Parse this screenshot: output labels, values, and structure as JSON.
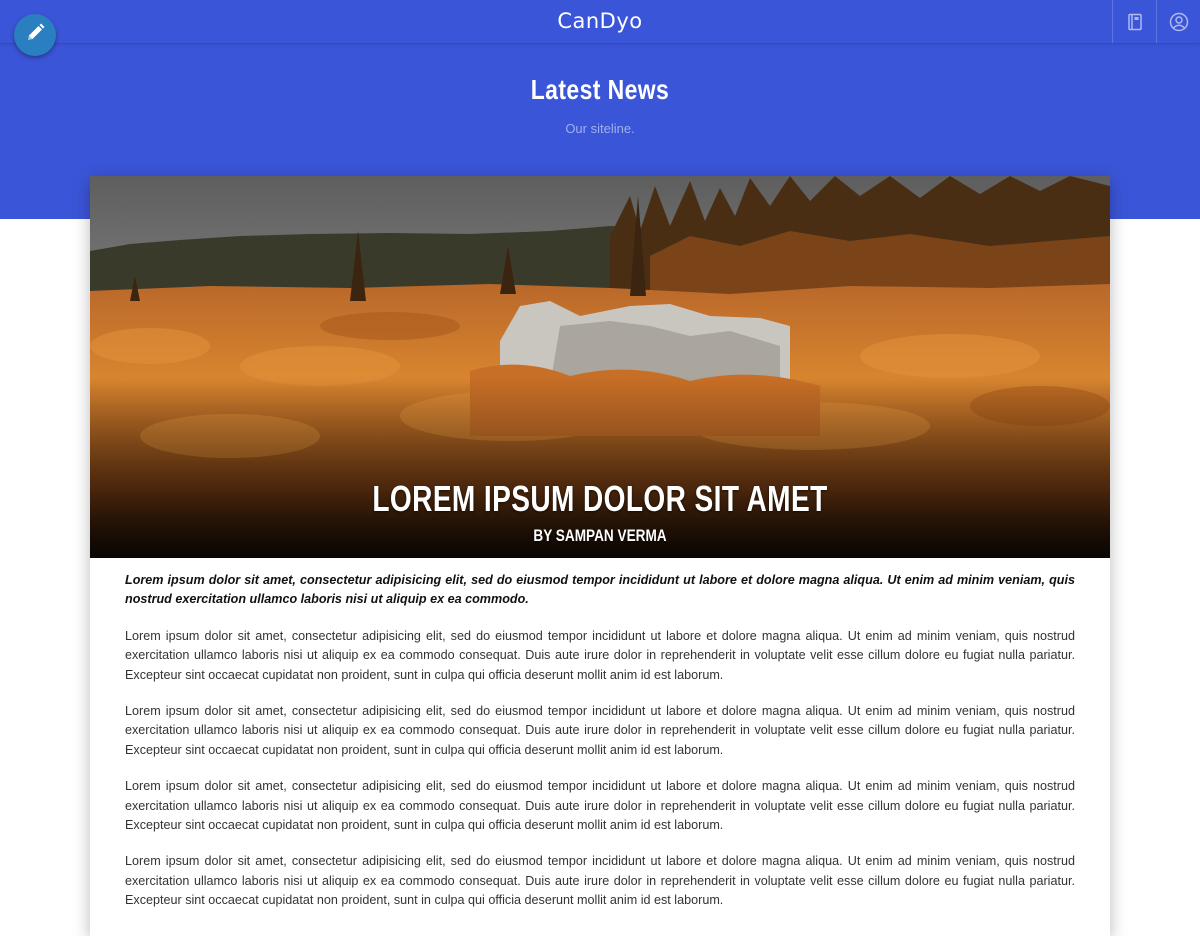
{
  "header": {
    "brand": "CanDyo",
    "icons": [
      "edit-icon",
      "book-icon",
      "user-icon"
    ],
    "accent_color": "#3b55d8"
  },
  "page": {
    "title": "Latest News",
    "subtitle": "Our siteline."
  },
  "article": {
    "title": "LOREM IPSUM DOLOR SIT AMET",
    "byline": "BY SAMPAN VERMA",
    "lead": "Lorem ipsum dolor sit amet, consectetur adipisicing elit, sed do eiusmod tempor incididunt ut labore et dolore magna aliqua. Ut enim ad minim veniam, quis nostrud exercitation ullamco laboris nisi ut aliquip ex ea commodo.",
    "paragraphs": [
      "Lorem ipsum dolor sit amet, consectetur adipisicing elit, sed do eiusmod tempor incididunt ut labore et dolore magna aliqua. Ut enim ad minim veniam, quis nostrud exercitation ullamco laboris nisi ut aliquip ex ea commodo consequat. Duis aute irure dolor in reprehenderit in voluptate velit esse cillum dolore eu fugiat nulla pariatur. Excepteur sint occaecat cupidatat non proident, sunt in culpa qui officia deserunt mollit anim id est laborum.",
      "Lorem ipsum dolor sit amet, consectetur adipisicing elit, sed do eiusmod tempor incididunt ut labore et dolore magna aliqua. Ut enim ad minim veniam, quis nostrud exercitation ullamco laboris nisi ut aliquip ex ea commodo consequat. Duis aute irure dolor in reprehenderit in voluptate velit esse cillum dolore eu fugiat nulla pariatur. Excepteur sint occaecat cupidatat non proident, sunt in culpa qui officia deserunt mollit anim id est laborum.",
      "Lorem ipsum dolor sit amet, consectetur adipisicing elit, sed do eiusmod tempor incididunt ut labore et dolore magna aliqua. Ut enim ad minim veniam, quis nostrud exercitation ullamco laboris nisi ut aliquip ex ea commodo consequat. Duis aute irure dolor in reprehenderit in voluptate velit esse cillum dolore eu fugiat nulla pariatur. Excepteur sint occaecat cupidatat non proident, sunt in culpa qui officia deserunt mollit anim id est laborum.",
      "Lorem ipsum dolor sit amet, consectetur adipisicing elit, sed do eiusmod tempor incididunt ut labore et dolore magna aliqua. Ut enim ad minim veniam, quis nostrud exercitation ullamco laboris nisi ut aliquip ex ea commodo consequat. Duis aute irure dolor in reprehenderit in voluptate velit esse cillum dolore eu fugiat nulla pariatur. Excepteur sint occaecat cupidatat non proident, sunt in culpa qui officia deserunt mollit anim id est laborum."
    ]
  }
}
